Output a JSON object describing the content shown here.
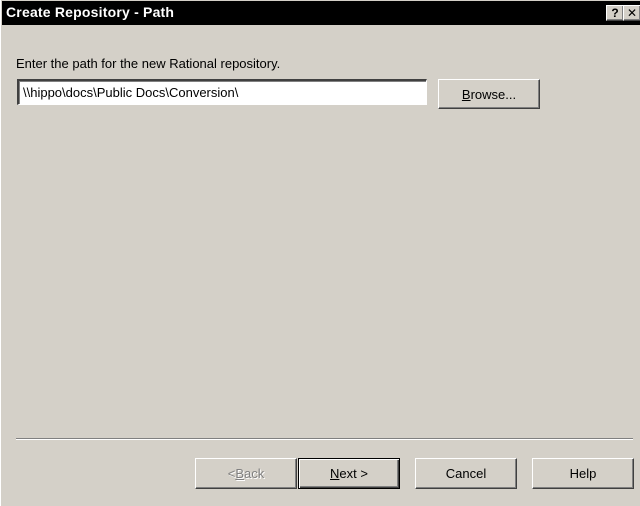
{
  "window": {
    "title": "Create Repository - Path",
    "help_glyph": "?",
    "close_glyph": "✕"
  },
  "form": {
    "prompt": "Enter the path for the new Rational repository.",
    "path_value": "\\\\hippo\\docs\\Public Docs\\Conversion\\",
    "browse_mnemonic": "B",
    "browse_rest": "rowse..."
  },
  "footer": {
    "back_prefix": "< ",
    "back_mnemonic": "B",
    "back_rest": "ack",
    "next_mnemonic": "N",
    "next_rest": "ext >",
    "cancel_label": "Cancel",
    "help_label": "Help"
  },
  "colors": {
    "dialog_bg": "#d4d0c8",
    "titlebar_bg": "#000000",
    "titlebar_text": "#ffffff",
    "disabled_text": "#808080"
  },
  "icons": {
    "help": "question-mark-icon",
    "close": "close-icon"
  }
}
